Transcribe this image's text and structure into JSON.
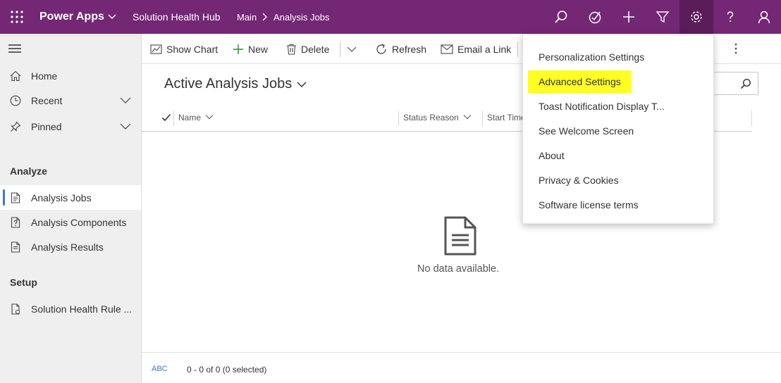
{
  "topbar": {
    "app_name": "Power Apps",
    "hub_name": "Solution Health Hub",
    "breadcrumb_main": "Main",
    "breadcrumb_page": "Analysis Jobs",
    "icons": [
      "waffle-icon",
      "search-icon",
      "assistant-icon",
      "plus-icon",
      "filter-icon",
      "settings-icon",
      "help-icon",
      "user-icon"
    ],
    "color": "#742774"
  },
  "leftnav": {
    "items": [
      {
        "label": "Home",
        "icon": "home-icon"
      },
      {
        "label": "Recent",
        "icon": "clock-icon"
      },
      {
        "label": "Pinned",
        "icon": "pin-icon"
      }
    ],
    "section_analyze": "Analyze",
    "analyze_items": [
      {
        "label": "Analysis Jobs",
        "icon": "document-icon",
        "selected": true
      },
      {
        "label": "Analysis Components",
        "icon": "document-question-icon"
      },
      {
        "label": "Analysis Results",
        "icon": "document-list-icon"
      }
    ],
    "section_setup": "Setup",
    "setup_items": [
      {
        "label": "Solution Health Rule ...",
        "icon": "rule-icon"
      }
    ]
  },
  "commandbar": {
    "show_chart": "Show Chart",
    "new": "New",
    "delete": "Delete",
    "refresh": "Refresh",
    "email_link": "Email a Link"
  },
  "view": {
    "title": "Active Analysis Jobs",
    "columns": [
      "Name",
      "Status Reason",
      "Start Time"
    ],
    "empty_text": "No data available.",
    "footer_abc": "ABC",
    "footer_count": "0 - 0 of 0 (0 selected)"
  },
  "settings_menu": {
    "items": [
      "Personalization Settings",
      "Advanced Settings",
      "Toast Notification Display T...",
      "See Welcome Screen",
      "About",
      "Privacy & Cookies",
      "Software license terms"
    ],
    "highlight_color": "#ffff22"
  }
}
